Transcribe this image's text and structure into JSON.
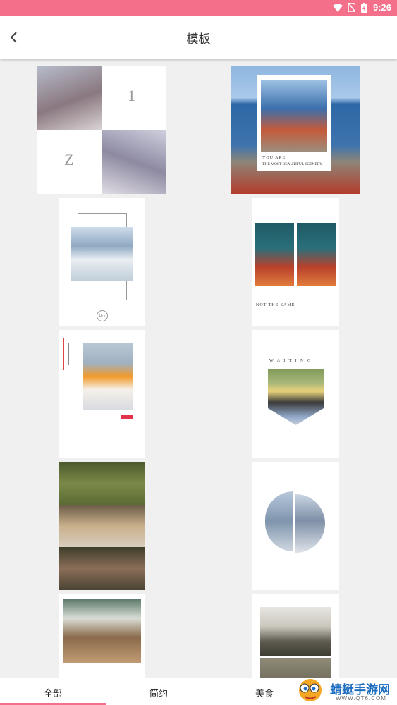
{
  "status": {
    "time": "9:26"
  },
  "header": {
    "title": "模板"
  },
  "templates": {
    "t1": {
      "num1": "1",
      "num2": "Z"
    },
    "t2": {
      "line1": "YOU ARE",
      "line2": "THE MOST BEAUTIFUL SCENERY"
    },
    "t3": {
      "badge": "LIFE"
    },
    "t4": {
      "caption": "NOT THE SAME"
    },
    "t6": {
      "caption": "W A I T I N G"
    }
  },
  "tabs": [
    {
      "label": "全部"
    },
    {
      "label": "简约"
    },
    {
      "label": "美食"
    }
  ],
  "watermark": {
    "brand": "蜻蜓手游网",
    "url": "WWW.QT6.COM"
  },
  "colors": {
    "accent": "#f36f8a"
  }
}
